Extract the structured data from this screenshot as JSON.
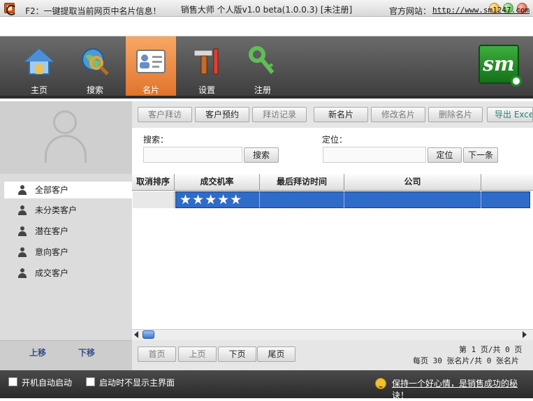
{
  "window": {
    "title": "销售大师 个人版v1.0 beta(1.0.0.3) [未注册]"
  },
  "infobar": {
    "hint": "F2：一键提取当前网页中名片信息！",
    "site_label": "官方网站：",
    "site_url": "http://www.sm1247.com"
  },
  "nav": [
    {
      "label": "主页",
      "icon": "house-icon"
    },
    {
      "label": "搜索",
      "icon": "globe-search-icon"
    },
    {
      "label": "名片",
      "icon": "business-card-icon",
      "active": true
    },
    {
      "label": "设置",
      "icon": "tools-icon"
    },
    {
      "label": "注册",
      "icon": "key-icon"
    }
  ],
  "logo": {
    "text": "sm"
  },
  "categories": [
    {
      "label": "全部客户",
      "selected": true
    },
    {
      "label": "未分类客户"
    },
    {
      "label": "潜在客户"
    },
    {
      "label": "意向客户"
    },
    {
      "label": "成交客户"
    }
  ],
  "left_footer": {
    "up": "上移",
    "down": "下移"
  },
  "actions": {
    "visit": "客户拜访",
    "reserve": "客户预约",
    "record": "拜访记录",
    "new_card": "新名片",
    "edit_card": "修改名片",
    "delete_card": "删除名片",
    "export": "导出 Exce"
  },
  "search": {
    "label": "搜索：",
    "button": "搜索"
  },
  "locate": {
    "label": "定位：",
    "button": "定位",
    "next": "下一条"
  },
  "table": {
    "columns": [
      "取消排序",
      "成交机率",
      "最后拜访时间",
      "公司"
    ],
    "rows": [
      {
        "rating": "★★★★★",
        "rating_value": 5,
        "last_visit": "",
        "company": ""
      }
    ]
  },
  "pager": {
    "first": "首页",
    "prev": "上页",
    "next": "下页",
    "last": "尾页",
    "page_info": "第 1 页/共 0 页",
    "size_info": "每页 30 张名片/共 0 张名片"
  },
  "status": {
    "auto_start": "开机自动启动",
    "hide_main": "启动时不显示主界面",
    "slogan": "保持一个好心情，是销售成功的秘诀！"
  }
}
